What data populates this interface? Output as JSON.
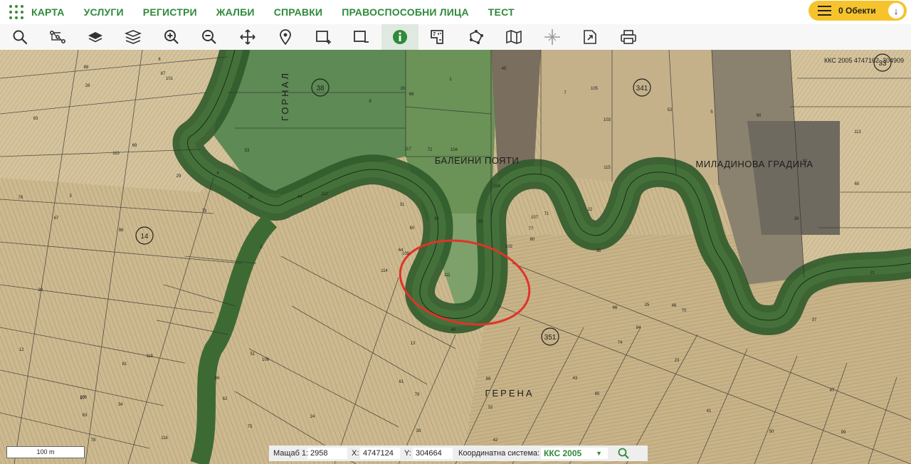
{
  "nav": {
    "items": [
      "КАРТА",
      "УСЛУГИ",
      "РЕГИСТРИ",
      "ЖАЛБИ",
      "СПРАВКИ",
      "ПРАВОСПОСОБНИ ЛИЦА",
      "ТЕСТ"
    ],
    "objects_label": "0 Обекти"
  },
  "toolbar": {
    "tools": [
      "search-icon",
      "route-icon",
      "layer-icon",
      "layers-icon",
      "zoom-in-icon",
      "zoom-out-icon",
      "pan-icon",
      "pin-icon",
      "select-add-icon",
      "select-remove-icon",
      "info-icon",
      "measure-icon",
      "polygon-icon",
      "map-icon",
      "crosshair-icon",
      "export-icon",
      "print-icon"
    ],
    "active_tool": "info-icon"
  },
  "map": {
    "coords": "ККС 2005 4747162, 304909",
    "labels": {
      "balein": "БАЛЕИНИ ПОЯТИ",
      "miladin": "МИЛАДИНОВА ГРАДИНА",
      "gerena": "ГЕРЕНА",
      "gornal": "ГОРНАЛ"
    },
    "circle_numbers": [
      "14",
      "351",
      "341",
      "33",
      "38"
    ],
    "parcel_numbers": [
      "111",
      "110",
      "109",
      "108",
      "107",
      "106",
      "105",
      "104",
      "103",
      "102",
      "101",
      "99",
      "98",
      "113",
      "114",
      "115",
      "116",
      "117",
      "118",
      "119",
      "112",
      "63",
      "62",
      "72",
      "71",
      "70",
      "69",
      "68",
      "67",
      "66",
      "65",
      "64",
      "61",
      "60",
      "53",
      "52",
      "51",
      "50",
      "47",
      "46",
      "45",
      "44",
      "73",
      "74",
      "75",
      "76",
      "77",
      "78",
      "79",
      "80",
      "81",
      "82",
      "83",
      "84",
      "85",
      "86",
      "87",
      "88",
      "89",
      "90",
      "1",
      "2",
      "3",
      "4",
      "5",
      "6",
      "7",
      "8",
      "10",
      "12",
      "13",
      "24",
      "25",
      "26",
      "27",
      "28",
      "29",
      "30",
      "31",
      "32",
      "33",
      "34",
      "36",
      "37",
      "38",
      "39",
      "40",
      "41",
      "42",
      "43",
      "20",
      "21",
      "22",
      "23"
    ],
    "scale_label": "100 m",
    "highlight_color": "#e0332a"
  },
  "statusbar": {
    "scale_label": "Мащаб 1:",
    "scale_value": "2958",
    "x_label": "X:",
    "x_value": "4747124",
    "y_label": "Y:",
    "y_value": "304664",
    "crs_label": "Координатна система:",
    "crs_value": "ККС 2005"
  },
  "colors": {
    "brand_green": "#2f8a3a",
    "objects_yellow": "#f6c32c"
  }
}
